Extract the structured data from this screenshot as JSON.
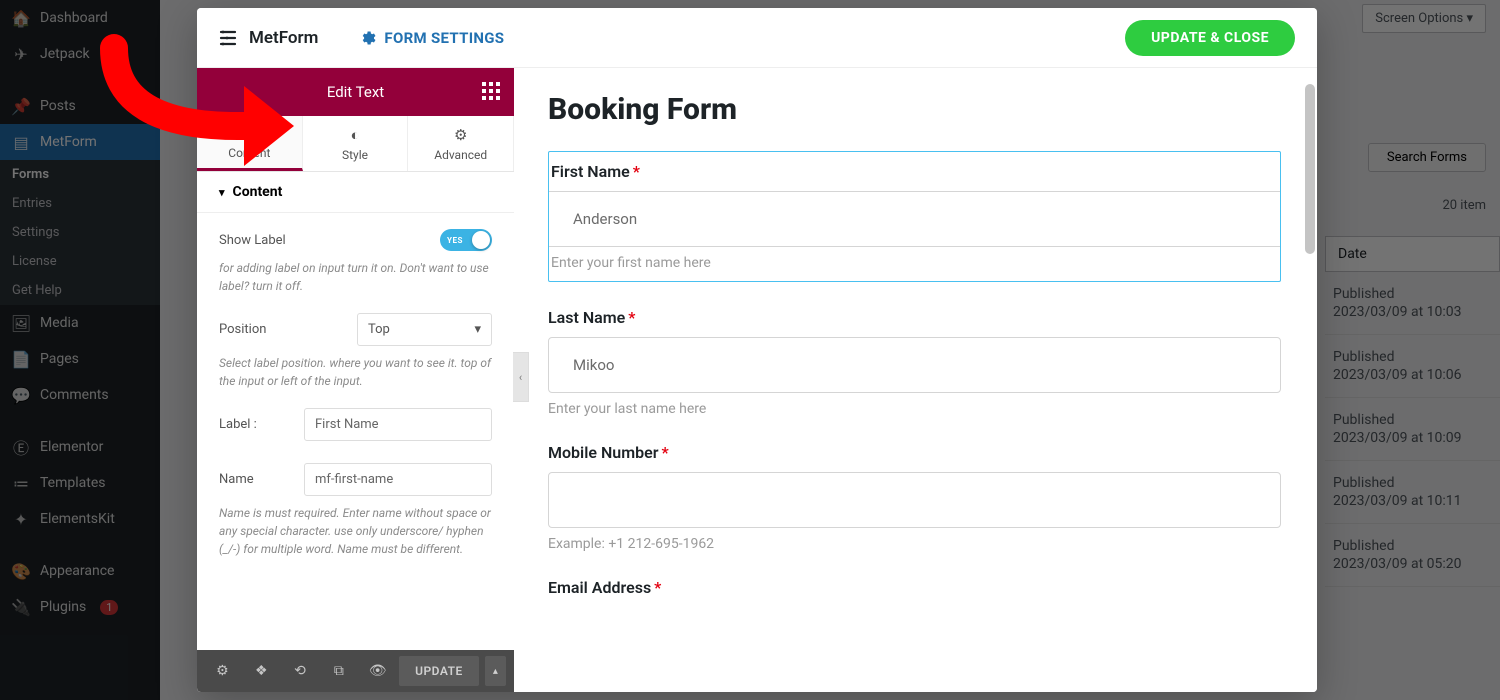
{
  "wp_sidebar": {
    "items": [
      {
        "icon": "🏠",
        "label": "Dashboard"
      },
      {
        "icon": "✈",
        "label": "Jetpack"
      },
      {
        "icon": "📌",
        "label": "Posts"
      },
      {
        "icon": "▤",
        "label": "MetForm"
      },
      {
        "icon": "🖼",
        "label": "Media"
      },
      {
        "icon": "📄",
        "label": "Pages"
      },
      {
        "icon": "💬",
        "label": "Comments"
      },
      {
        "icon": "Ⓔ",
        "label": "Elementor"
      },
      {
        "icon": "≔",
        "label": "Templates"
      },
      {
        "icon": "✦",
        "label": "ElementsKit"
      },
      {
        "icon": "🎨",
        "label": "Appearance"
      },
      {
        "icon": "🔌",
        "label": "Plugins"
      }
    ],
    "sub": [
      "Forms",
      "Entries",
      "Settings",
      "License",
      "Get Help"
    ],
    "plugins_badge": "1"
  },
  "top_right": {
    "screen_options": "Screen Options ▾",
    "search_forms": "Search Forms",
    "items_count": "20 item"
  },
  "bg_table": {
    "date_h": "Date",
    "rows": [
      {
        "s": "Published",
        "d": "2023/03/09 at 10:03"
      },
      {
        "s": "Published",
        "d": "2023/03/09 at 10:06"
      },
      {
        "s": "Published",
        "d": "2023/03/09 at 10:09"
      },
      {
        "s": "Published",
        "d": "2023/03/09 at 10:11"
      },
      {
        "s": "Published",
        "d": "2023/03/09 at 05:20"
      }
    ]
  },
  "modal": {
    "brand": "MetForm",
    "settings": "FORM SETTINGS",
    "update_close": "UPDATE & CLOSE",
    "panel_title": "Edit Text",
    "tabs": [
      "Content",
      "Style",
      "Advanced"
    ],
    "acc": "Content",
    "show_label": "Show Label",
    "toggle_txt": "YES",
    "show_label_hint": "for adding label on input turn it on. Don't want to use label? turn it off.",
    "position_label": "Position",
    "position_value": "Top",
    "position_hint": "Select label position. where you want to see it. top of the input or left of the input.",
    "label_field": "Label :",
    "label_value": "First Name",
    "name_field": "Name",
    "name_value": "mf-first-name",
    "name_hint": "Name is must required. Enter name without space or any special character. use only underscore/ hyphen (_/-) for multiple word. Name must be different.",
    "update_btn": "UPDATE"
  },
  "preview": {
    "title": "Booking Form",
    "fields": [
      {
        "l": "First Name",
        "r": true,
        "ph": "Anderson",
        "d": "Enter your first name here"
      },
      {
        "l": "Last Name",
        "r": true,
        "ph": "Mikoo",
        "d": "Enter your last name here"
      },
      {
        "l": "Mobile Number",
        "r": true,
        "ph": "",
        "d": "Example: +1 212-695-1962"
      },
      {
        "l": "Email Address",
        "r": true,
        "ph": "",
        "d": ""
      }
    ]
  }
}
